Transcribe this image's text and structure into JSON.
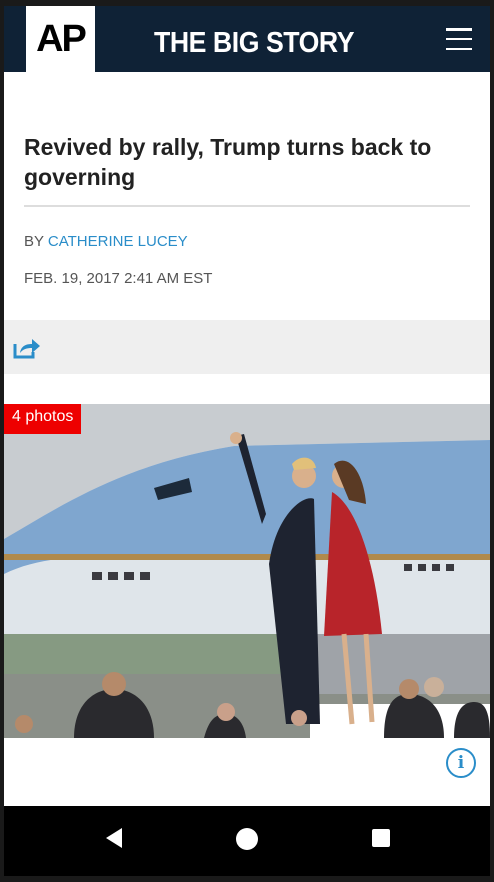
{
  "header": {
    "logo": "AP",
    "title": "THE BIG STORY",
    "menu_icon": "hamburger-menu-icon"
  },
  "article": {
    "headline": "Revived by rally, Trump turns back to governing",
    "byline_prefix": "BY",
    "author": "CATHERINE LUCEY",
    "date": "FEB. 19, 2017 2:41 AM EST"
  },
  "share": {
    "icon": "share-icon"
  },
  "photo": {
    "badge": "4 photos",
    "info_label": "i"
  },
  "navbar": {
    "back_icon": "back-triangle-icon",
    "home_icon": "home-circle-icon",
    "recents_icon": "recents-square-icon"
  },
  "colors": {
    "header_bg": "#0f2236",
    "link": "#2a8dc9",
    "badge": "#ee0000"
  }
}
